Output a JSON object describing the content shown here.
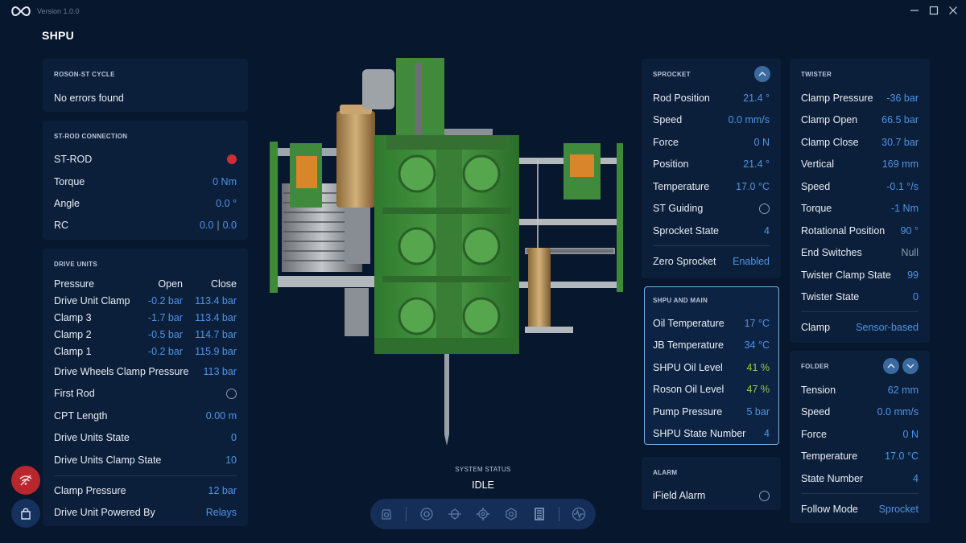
{
  "window": {
    "logo_icon": "infinity-logo-icon",
    "version": "Version 1.0.0",
    "title": "SHPU",
    "controls": [
      "minimize-icon",
      "maximize-icon",
      "close-icon"
    ]
  },
  "roson_cycle": {
    "header": "ROSON-ST CYCLE",
    "message": "No errors found"
  },
  "st_rod": {
    "header": "ST-ROD CONNECTION",
    "rows": [
      {
        "label": "ST-ROD",
        "indicator": "red"
      },
      {
        "label": "Torque",
        "value": "0 Nm"
      },
      {
        "label": "Angle",
        "value": "0.0 °"
      },
      {
        "label": "RC",
        "value_a": "0.0",
        "value_b": "0.0"
      }
    ]
  },
  "drive_units": {
    "header": "DRIVE UNITS",
    "table_header": {
      "label": "Pressure",
      "open": "Open",
      "close": "Close"
    },
    "table_rows": [
      {
        "label": "Drive Unit Clamp",
        "open": "-0.2 bar",
        "close": "113.4 bar"
      },
      {
        "label": "Clamp 3",
        "open": "-1.7 bar",
        "close": "113.4 bar"
      },
      {
        "label": "Clamp 2",
        "open": "-0.5 bar",
        "close": "114.7 bar"
      },
      {
        "label": "Clamp 1",
        "open": "-0.2 bar",
        "close": "115.9 bar"
      }
    ],
    "rows": [
      {
        "label": "Drive Wheels Clamp Pressure",
        "value": "113 bar"
      },
      {
        "label": "First Rod",
        "indicator": "off"
      },
      {
        "label": "CPT Length",
        "value": "0.00 m"
      },
      {
        "label": "Drive Units State",
        "value": "0"
      },
      {
        "label": "Drive Units Clamp State",
        "value": "10"
      }
    ],
    "footer_rows": [
      {
        "label": "Clamp Pressure",
        "value": "12 bar"
      },
      {
        "label": "Drive Unit Powered By",
        "value": "Relays"
      }
    ]
  },
  "sprocket": {
    "header": "SPROCKET",
    "collapse_icon": "chevron-up-icon",
    "rows": [
      {
        "label": "Rod Position",
        "value": "21.4 °"
      },
      {
        "label": "Speed",
        "value": "0.0 mm/s"
      },
      {
        "label": "Force",
        "value": "0 N"
      },
      {
        "label": "Position",
        "value": "21.4 °"
      },
      {
        "label": "Temperature",
        "value": "17.0 °C"
      },
      {
        "label": "ST Guiding",
        "indicator": "off"
      },
      {
        "label": "Sprocket State",
        "value": "4"
      }
    ],
    "footer_rows": [
      {
        "label": "Zero Sprocket",
        "value": "Enabled"
      }
    ]
  },
  "shpu_main": {
    "header": "SHPU AND MAIN",
    "rows": [
      {
        "label": "Oil Temperature",
        "value": "17 °C",
        "tone": "blue"
      },
      {
        "label": "JB Temperature",
        "value": "34 °C",
        "tone": "blue"
      },
      {
        "label": "SHPU Oil Level",
        "value": "41 %",
        "tone": "green"
      },
      {
        "label": "Roson Oil Level",
        "value": "47 %",
        "tone": "green"
      },
      {
        "label": "Pump Pressure",
        "value": "5 bar",
        "tone": "blue"
      },
      {
        "label": "SHPU State Number",
        "value": "4",
        "tone": "blue"
      }
    ]
  },
  "alarm": {
    "header": "ALARM",
    "rows": [
      {
        "label": "iField Alarm",
        "indicator": "off"
      }
    ]
  },
  "twister": {
    "header": "TWISTER",
    "rows": [
      {
        "label": "Clamp Pressure",
        "value": "-36 bar"
      },
      {
        "label": "Clamp Open",
        "value": "66.5 bar"
      },
      {
        "label": "Clamp Close",
        "value": "30.7 bar"
      },
      {
        "label": "Vertical",
        "value": "169 mm"
      },
      {
        "label": "Speed",
        "value": "-0.1 °/s"
      },
      {
        "label": "Torque",
        "value": "-1 Nm"
      },
      {
        "label": "Rotational Position",
        "value": "90 °"
      },
      {
        "label": "End Switches",
        "value": "Null"
      },
      {
        "label": "Twister Clamp State",
        "value": "99"
      },
      {
        "label": "Twister State",
        "value": "0"
      }
    ],
    "footer_rows": [
      {
        "label": "Clamp",
        "value": "Sensor-based"
      }
    ]
  },
  "folder": {
    "header": "FOLDER",
    "buttons": [
      "chevron-up-icon",
      "chevron-down-icon"
    ],
    "rows": [
      {
        "label": "Tension",
        "value": "62 mm"
      },
      {
        "label": "Speed",
        "value": "0.0 mm/s"
      },
      {
        "label": "Force",
        "value": "0 N"
      },
      {
        "label": "Temperature",
        "value": "17.0 °C"
      },
      {
        "label": "State Number",
        "value": "4"
      }
    ],
    "footer_rows": [
      {
        "label": "Follow Mode",
        "value": "Sprocket"
      }
    ]
  },
  "system_status": {
    "label": "SYSTEM STATUS",
    "value": "IDLE"
  },
  "toolbar": {
    "icons": [
      "tank-icon",
      "drive-wheel-icon",
      "rod-icon",
      "sprocket-icon",
      "twister-icon",
      "folder-icon",
      "waveform-icon"
    ]
  },
  "floating": {
    "wifi_off_icon": "wifi-off-icon",
    "bag_icon": "bag-icon"
  },
  "colors": {
    "background": "#07172d",
    "panel": "#0c1f3a",
    "value_blue": "#4e94e6",
    "value_green": "#95cf3b",
    "alert_red": "#cf2e35",
    "machine_green": "#3f8b3b"
  }
}
